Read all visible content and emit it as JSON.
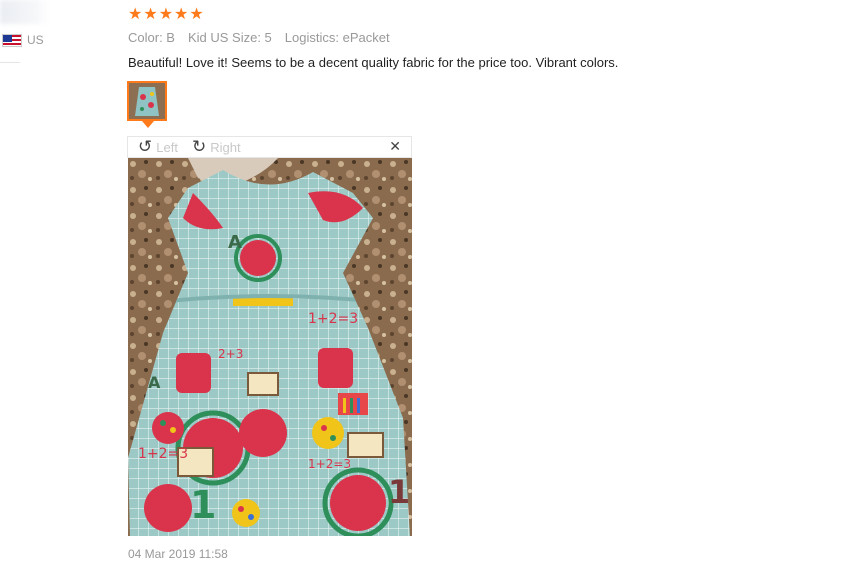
{
  "reviewer": {
    "country_code": "US",
    "flag_icon": "us-flag-icon"
  },
  "review": {
    "rating": 5,
    "rating_max": 5,
    "star_color": "#ff7a1a",
    "attributes": {
      "color": "Color: B",
      "size": "Kid US Size: 5",
      "logistics": "Logistics: ePacket"
    },
    "text": "Beautiful! Love it! Seems to be a decent quality fabric for the price too. Vibrant colors.",
    "date": "04 Mar 2019 11:58"
  },
  "image_viewer": {
    "rotate_left_label": "Left",
    "rotate_right_label": "Right",
    "rotate_left_icon": "rotate-left-icon",
    "rotate_right_icon": "rotate-right-icon",
    "close_icon": "close-icon",
    "close_symbol": "✕",
    "accent_color": "#ff7a1a"
  }
}
